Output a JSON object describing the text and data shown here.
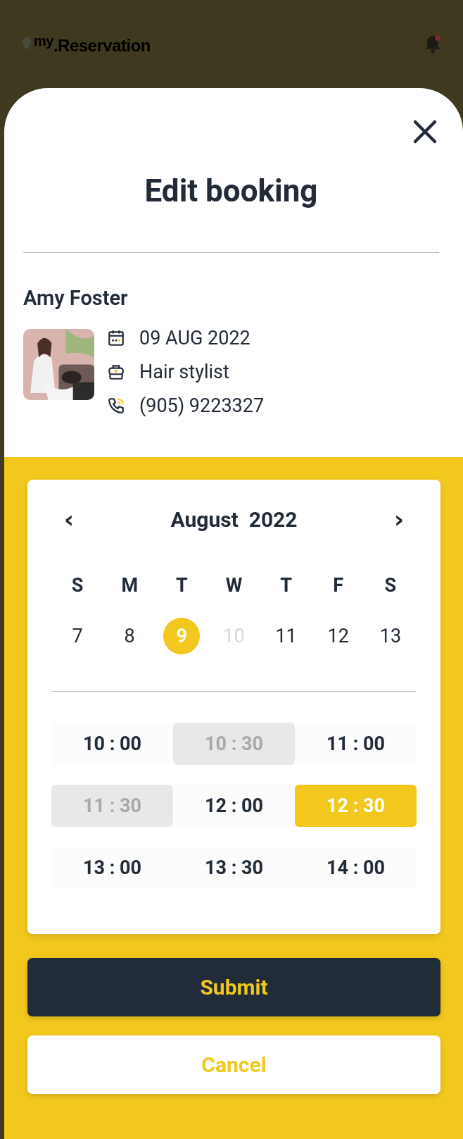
{
  "header": {
    "logo": "$^{my}$.Reservation",
    "notification": true
  },
  "sheet": {
    "title": "Edit booking"
  },
  "booking": {
    "name": "Amy Foster",
    "details": [
      {
        "kind": "date",
        "text": "09 AUG 2022"
      },
      {
        "kind": "service",
        "text": "Hair stylist"
      },
      {
        "kind": "phone",
        "text": "(905) 9223327"
      }
    ]
  },
  "calendar": {
    "month": "August  2022",
    "prev": "‹",
    "next": "›",
    "weekdays": [
      "S",
      "M",
      "T",
      "W",
      "T",
      "F",
      "S"
    ],
    "days": [
      {
        "label": "7",
        "selected": false,
        "disabled": false
      },
      {
        "label": "8",
        "selected": false,
        "disabled": false
      },
      {
        "label": "9",
        "selected": true,
        "disabled": false
      },
      {
        "label": "10",
        "selected": false,
        "disabled": true
      },
      {
        "label": "11",
        "selected": false,
        "disabled": false
      },
      {
        "label": "12",
        "selected": false,
        "disabled": false
      },
      {
        "label": "13",
        "selected": false,
        "disabled": false
      }
    ],
    "times": [
      {
        "label": "10 : 00",
        "selected": false,
        "disabled": false
      },
      {
        "label": "10 : 30",
        "selected": false,
        "disabled": true
      },
      {
        "label": "11 : 00",
        "selected": false,
        "disabled": false
      },
      {
        "label": "11 : 30",
        "selected": false,
        "disabled": true
      },
      {
        "label": "12 : 00",
        "selected": false,
        "disabled": false
      },
      {
        "label": "12 : 30",
        "selected": true,
        "disabled": false
      },
      {
        "label": "13 : 00",
        "selected": false,
        "disabled": false
      },
      {
        "label": "13 : 30",
        "selected": false,
        "disabled": false
      },
      {
        "label": "14 : 00",
        "selected": false,
        "disabled": false
      }
    ]
  },
  "buttons": [
    {
      "kind": "primary",
      "label": "Submit"
    },
    {
      "kind": "secondary",
      "label": "Cancel"
    }
  ]
}
